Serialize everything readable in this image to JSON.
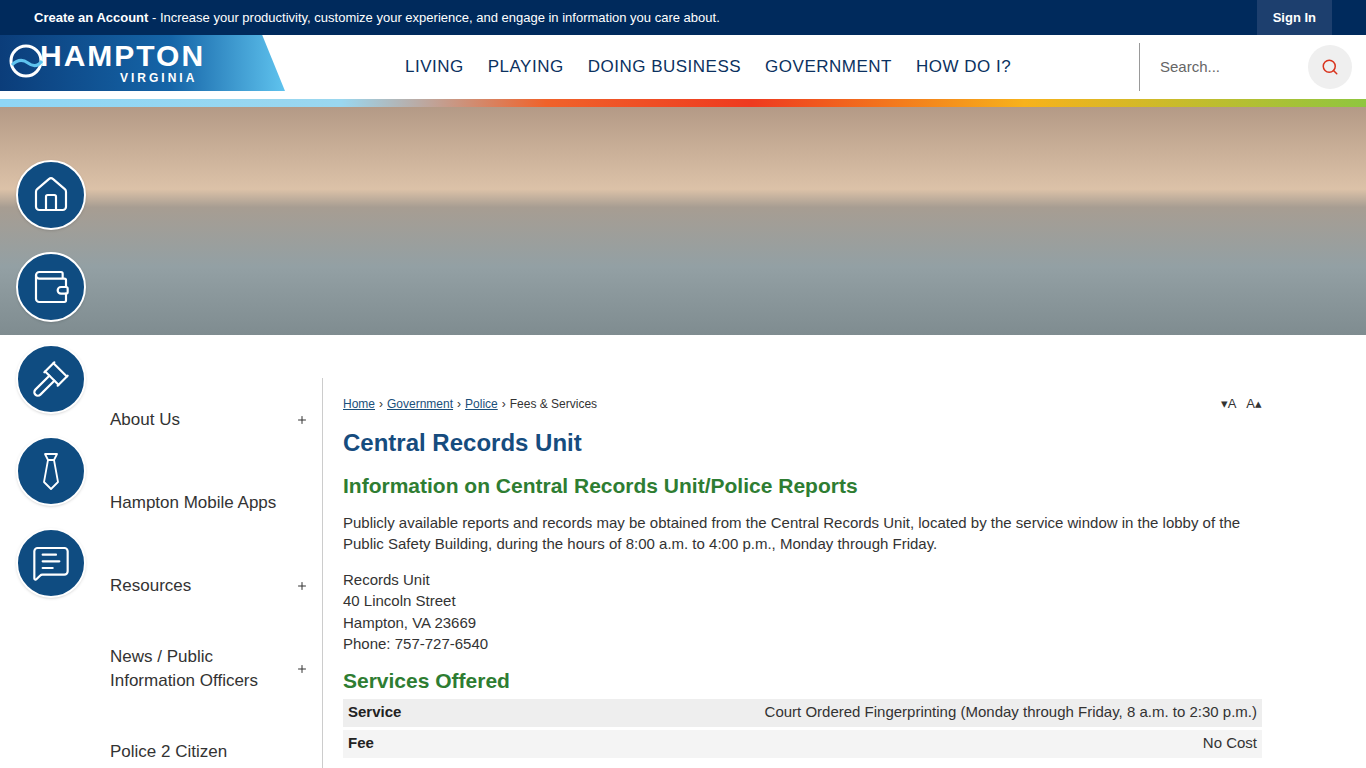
{
  "top_bar": {
    "create_account": "Create an Account",
    "tagline": " - Increase your productivity, customize your experience, and engage in information you care about.",
    "sign_in": "Sign In"
  },
  "logo": {
    "name": "HAMPTON",
    "state": "VIRGINIA"
  },
  "nav": [
    "LIVING",
    "PLAYING",
    "DOING BUSINESS",
    "GOVERNMENT",
    "HOW DO I?"
  ],
  "search": {
    "placeholder": "Search..."
  },
  "quick_links": [
    "home",
    "wallet",
    "gavel",
    "tie",
    "chat"
  ],
  "sidebar": {
    "items": [
      {
        "label": "About Us",
        "expandable": true
      },
      {
        "label": "Hampton Mobile Apps",
        "expandable": false
      },
      {
        "label": "Resources",
        "expandable": true
      },
      {
        "label": "News / Public Information Officers",
        "expandable": true
      },
      {
        "label": "Police 2 Citizen",
        "expandable": false
      }
    ]
  },
  "breadcrumb": [
    {
      "label": "Home",
      "link": true
    },
    {
      "label": "Government",
      "link": true
    },
    {
      "label": "Police",
      "link": true
    },
    {
      "label": "Fees & Services",
      "link": false
    }
  ],
  "breadcrumb_separator": "›",
  "font_controls": {
    "decrease": "▾A",
    "increase": "A▴"
  },
  "title": "Central Records Unit",
  "section_heading": "Information on Central Records Unit/Police Reports",
  "paragraph": "Publicly available reports and records may be obtained from the Central Records Unit, located by the service window in the lobby of the Public Safety Building, during the hours of 8:00 a.m. to 4:00 p.m., Monday through Friday.",
  "address": [
    "Records Unit",
    "40 Lincoln Street",
    "Hampton, VA 23669",
    "Phone: 757-727-6540"
  ],
  "services_heading": "Services Offered",
  "services_table": [
    {
      "label": "Service",
      "value": "Court Ordered Fingerprinting (Monday through Friday, 8 a.m. to 2:30 p.m.)"
    },
    {
      "label": "Fee",
      "value": "No Cost"
    }
  ]
}
